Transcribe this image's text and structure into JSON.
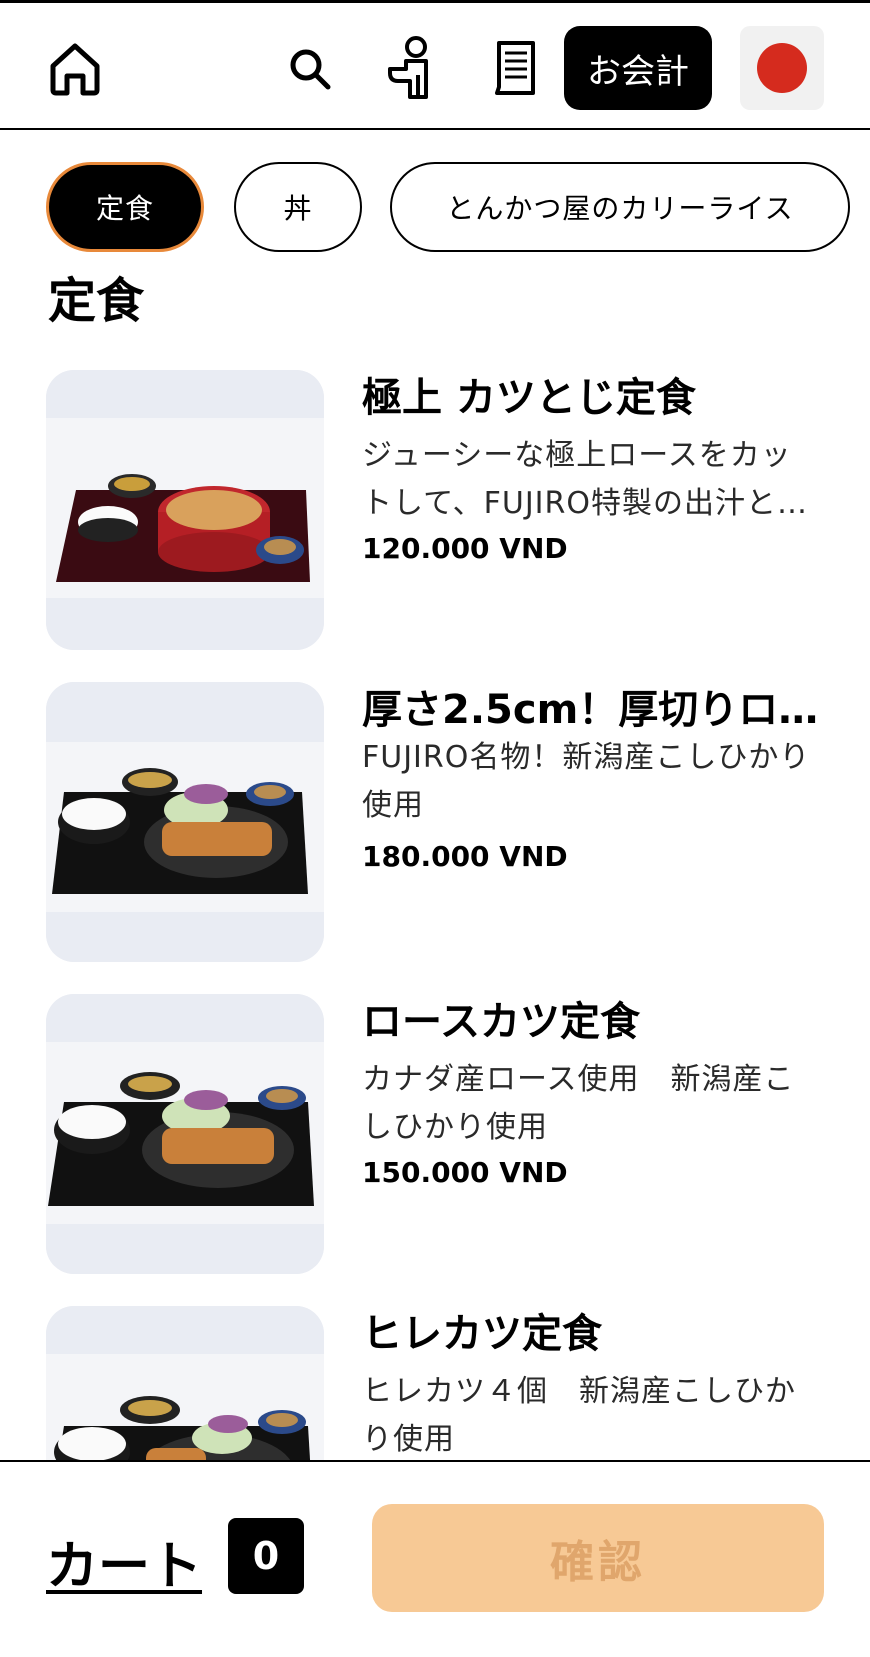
{
  "header": {
    "home_icon": "home-icon",
    "search_icon": "search-icon",
    "staff_call_icon": "staff-call-icon",
    "receipt_icon": "receipt-icon",
    "checkout_label": "お会計",
    "language_flag": "japan-flag-icon",
    "flag_color": "#d52b1e"
  },
  "tabs": [
    {
      "label": "定食",
      "active": true
    },
    {
      "label": "丼",
      "active": false
    },
    {
      "label": "とんかつ屋のカリーライス",
      "active": false
    }
  ],
  "section_title": "定食",
  "menu_items": [
    {
      "name": "極上 カツとじ定食",
      "description": "ジューシーな極上ロースをカットして、FUJIRO特製の出汁と…",
      "price": "120.000 VND"
    },
    {
      "name": "厚さ2.5cm！厚切りロ…",
      "description": "FUJIRO名物！新潟産こしひかり使用",
      "price": "180.000 VND"
    },
    {
      "name": "ロースカツ定食",
      "description": "カナダ産ロース使用　新潟産こしひかり使用",
      "price": "150.000 VND"
    },
    {
      "name": "ヒレカツ定食",
      "description": "ヒレカツ４個　新潟産こしひかり使用",
      "price": ""
    }
  ],
  "footer": {
    "cart_label": "カート",
    "cart_count": "0",
    "confirm_label": "確認",
    "confirm_color": "#f7c995"
  },
  "colors": {
    "accent_orange": "#e8893a",
    "primary": "#000000"
  }
}
